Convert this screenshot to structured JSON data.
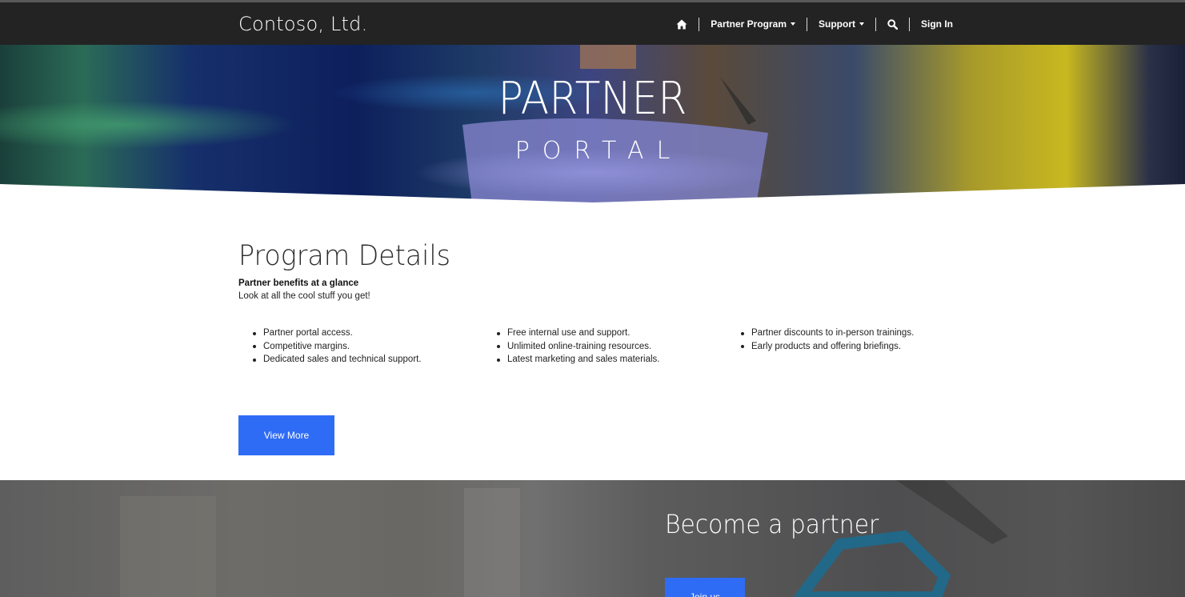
{
  "navbar": {
    "brand": "Contoso, Ltd.",
    "home_icon": "home-icon",
    "items": [
      {
        "label": "Partner Program",
        "has_dropdown": true
      },
      {
        "label": "Support",
        "has_dropdown": true
      }
    ],
    "search_icon": "search-icon",
    "sign_in": "Sign In"
  },
  "hero": {
    "title": "PARTNER",
    "subtitle": "PORTAL"
  },
  "program_details": {
    "title": "Program Details",
    "subtitle": "Partner benefits at a glance",
    "description": "Look at all the cool stuff you get!",
    "benefit_columns": [
      [
        "Partner portal access.",
        "Competitive margins.",
        "Dedicated sales and technical support."
      ],
      [
        "Free internal use and support.",
        "Unlimited online-training resources.",
        "Latest marketing and sales materials."
      ],
      [
        "Partner discounts to in-person trainings.",
        "Early products and offering briefings."
      ]
    ],
    "button_label": "View More"
  },
  "become_partner": {
    "title": "Become a partner",
    "button_label": "Join us"
  },
  "colors": {
    "navbar_bg": "#232323",
    "accent": "#2f6cf6"
  }
}
